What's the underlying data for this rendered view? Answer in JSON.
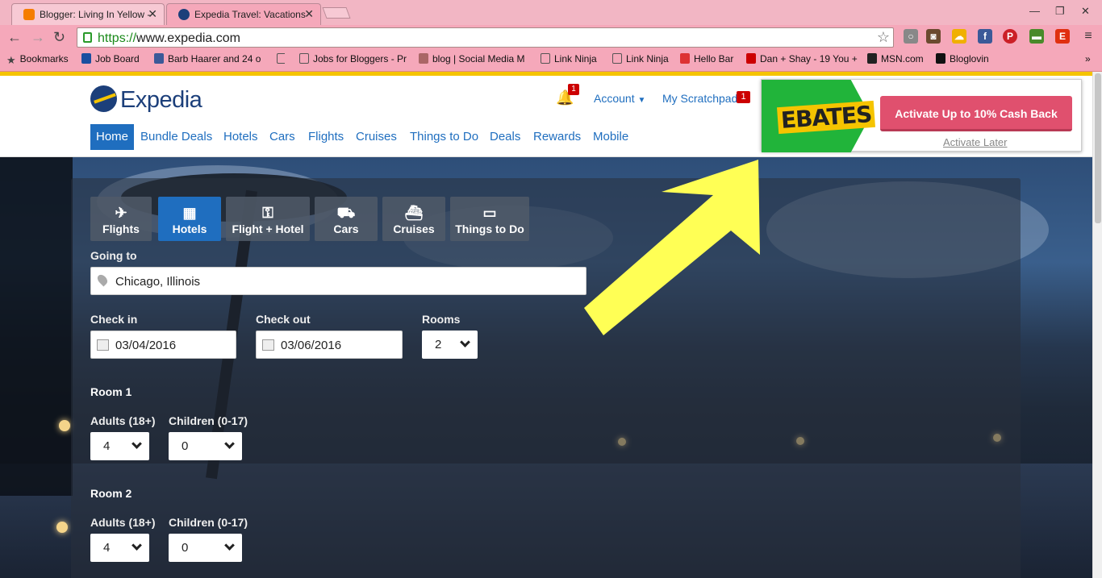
{
  "browser": {
    "tabs": [
      {
        "title": "Blogger: Living In Yellow -",
        "favicon_color": "#f57d00"
      },
      {
        "title": "Expedia Travel: Vacations",
        "favicon_color": "#1c3f7a"
      }
    ],
    "url_scheme": "https://",
    "url_host": "www.expedia.com",
    "bookmarks_label": "Bookmarks",
    "bookmarks": [
      {
        "label": "Job Board"
      },
      {
        "label": "Barb Haarer and 24 o"
      },
      {
        "label": "Jobs for Bloggers - Pr"
      },
      {
        "label": "blog | Social Media M"
      },
      {
        "label": "Link Ninja"
      },
      {
        "label": "Link Ninja"
      },
      {
        "label": "Hello Bar"
      },
      {
        "label": "Dan + Shay - 19 You +"
      },
      {
        "label": "MSN.com"
      },
      {
        "label": "Bloglovin"
      }
    ]
  },
  "site": {
    "logo_text": "Expedia",
    "notification_count": "1",
    "account_label": "Account",
    "scratchpad_label": "My Scratchpad",
    "scratchpad_count": "1",
    "nav": [
      "Home",
      "Bundle Deals",
      "Hotels",
      "Cars",
      "Flights",
      "Cruises",
      "Things to Do",
      "Deals",
      "Rewards",
      "Mobile"
    ]
  },
  "search": {
    "tabs": [
      {
        "label": "Flights",
        "icon": "plane-icon"
      },
      {
        "label": "Hotels",
        "icon": "hotel-icon"
      },
      {
        "label": "Flight + Hotel",
        "icon": "package-icon"
      },
      {
        "label": "Cars",
        "icon": "car-icon"
      },
      {
        "label": "Cruises",
        "icon": "cruise-icon"
      },
      {
        "label": "Things to Do",
        "icon": "ticket-icon"
      }
    ],
    "going_to_label": "Going to",
    "going_to_value": "Chicago, Illinois",
    "checkin_label": "Check in",
    "checkin_value": "03/04/2016",
    "checkout_label": "Check out",
    "checkout_value": "03/06/2016",
    "rooms_label": "Rooms",
    "rooms_value": "2",
    "rooms": [
      {
        "title": "Room 1",
        "adults_label": "Adults (18+)",
        "adults": "4",
        "children_label": "Children (0-17)",
        "children": "0"
      },
      {
        "title": "Room 2",
        "adults_label": "Adults (18+)",
        "adults": "4",
        "children_label": "Children (0-17)",
        "children": "0"
      }
    ]
  },
  "ebates": {
    "logo": "EBATES",
    "cta": "Activate Up to 10% Cash Back",
    "later": "Activate Later"
  },
  "colors": {
    "expedia_blue": "#1f6ebf",
    "ebates_green": "#21b43a",
    "cta_pink": "#e0506e",
    "annotation_arrow": "#ffff55"
  }
}
